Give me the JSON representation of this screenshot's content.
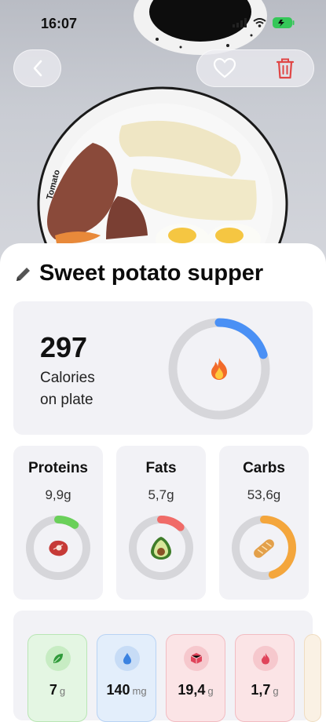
{
  "status": {
    "time": "16:07"
  },
  "meal": {
    "title": "Sweet potato supper"
  },
  "calories": {
    "value": "297",
    "label": "Calories\non plate",
    "progress": 0.2,
    "color": "#4a90f5"
  },
  "macros": [
    {
      "name": "Proteins",
      "value": "9,9g",
      "color": "#6ad05a",
      "progress": 0.1,
      "icon": "steak-icon"
    },
    {
      "name": "Fats",
      "value": "5,7g",
      "color": "#f06b68",
      "progress": 0.12,
      "icon": "avocado-icon"
    },
    {
      "name": "Carbs",
      "value": "53,6g",
      "color": "#f4a63c",
      "progress": 0.45,
      "icon": "bread-icon"
    }
  ],
  "nutrients": [
    {
      "value": "7",
      "unit": "g",
      "icon": "leaf-icon",
      "bg": "#e4f6e3",
      "border": "#b9e6b4",
      "circle": "#c7ecc3",
      "color": "#2f9a3a"
    },
    {
      "value": "140",
      "unit": "mg",
      "icon": "drop-icon",
      "bg": "#e3eefb",
      "border": "#b8d3f4",
      "circle": "#c7dcf6",
      "color": "#3b82e0"
    },
    {
      "value": "19,4",
      "unit": "g",
      "icon": "cube-icon",
      "bg": "#fbe4e6",
      "border": "#f2bcc2",
      "circle": "#f6c8cd",
      "color": "#e0435a"
    },
    {
      "value": "1,7",
      "unit": "g",
      "icon": "flame-icon",
      "bg": "#fbe4e6",
      "border": "#f2bcc2",
      "circle": "#f6c8cd",
      "color": "#e0435a"
    }
  ]
}
